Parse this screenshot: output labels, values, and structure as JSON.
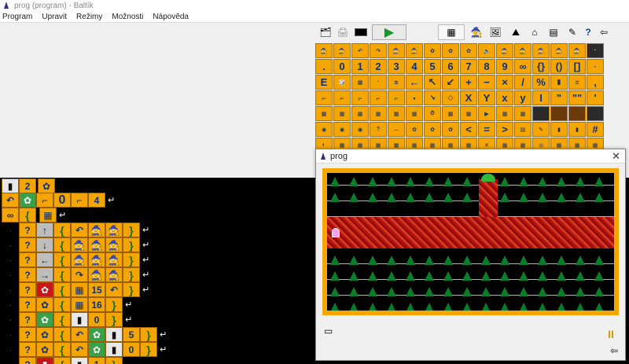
{
  "window": {
    "title": "prog (program) - Baltík",
    "menus": [
      {
        "label": "Program"
      },
      {
        "label": "Upravit"
      },
      {
        "label": "Režimy"
      },
      {
        "label": "Možnosti"
      },
      {
        "label": "Nápověda"
      }
    ]
  },
  "toolbar": {
    "run_glyph": "▶",
    "help_glyph": "?",
    "exit_glyph": "⇦"
  },
  "palette": {
    "row_digits": [
      "0",
      "1",
      "2",
      "3",
      "4",
      "5",
      "6",
      "7",
      "8",
      "9",
      "∞",
      "{}",
      "()",
      "[]"
    ],
    "row_ops": [
      "E",
      "",
      "",
      "",
      "",
      "",
      "+",
      "−",
      "×",
      "/",
      "%",
      "",
      "",
      ","
    ],
    "row_xy": [
      "X",
      "Y",
      "x",
      "y"
    ],
    "row_misc": [
      "<",
      "=",
      ">",
      "#"
    ]
  },
  "program": {
    "lines": [
      {
        "blocks": [
          "",
          "2",
          ""
        ]
      },
      {
        "blocks": [
          "",
          "",
          "",
          "0",
          ""
        ]
      },
      {
        "blocks": [
          "∞",
          "{",
          ""
        ]
      },
      {
        "blocks": [
          "?",
          "↑",
          "{",
          "",
          "",
          "}"
        ]
      },
      {
        "blocks": [
          "?",
          "↓",
          "{",
          "",
          "",
          "}"
        ]
      },
      {
        "blocks": [
          "?",
          "←",
          "{",
          "",
          "",
          "}"
        ]
      },
      {
        "blocks": [
          "?",
          "→",
          "{",
          "",
          "",
          "}"
        ]
      },
      {
        "blocks": [
          "?",
          "",
          "{",
          "",
          "15",
          "",
          "}"
        ]
      },
      {
        "blocks": [
          "?",
          "",
          "{",
          "",
          "16",
          "}"
        ]
      },
      {
        "blocks": [
          "?",
          "",
          "{",
          "",
          "0",
          "}"
        ]
      },
      {
        "blocks": [
          "?",
          "",
          "{",
          "",
          "",
          "",
          "5",
          "}"
        ]
      },
      {
        "blocks": [
          "?",
          "",
          "{",
          "",
          "",
          "",
          "0",
          "}"
        ]
      },
      {
        "blocks": [
          "?",
          "",
          "{",
          "",
          "1",
          "}"
        ]
      }
    ]
  },
  "program_window": {
    "title": "prog",
    "close_glyph": "✕",
    "pause_glyph": "II"
  },
  "colors": {
    "block": "#f4a500",
    "tree": "#0e7a2b",
    "path": "#b40f0f"
  }
}
